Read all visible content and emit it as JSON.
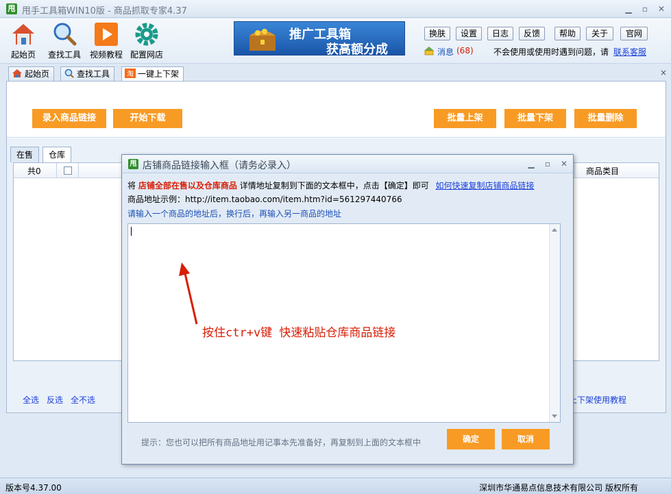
{
  "app": {
    "logo": "甩",
    "title": "甩手工具箱WIN10版 - 商品抓取专家4.37"
  },
  "window_controls": {
    "minimize": "▁",
    "maximize": "▫",
    "close": "✕"
  },
  "toolbar": {
    "items": [
      {
        "label": "起始页",
        "icon": "home-icon"
      },
      {
        "label": "查找工具",
        "icon": "magnifier-icon"
      },
      {
        "label": "视频教程",
        "icon": "play-icon"
      },
      {
        "label": "配置网店",
        "icon": "gear-icon"
      }
    ]
  },
  "banner": {
    "line1": "推广工具箱",
    "line2": "获高额分成"
  },
  "system_buttons": [
    "换肤",
    "设置",
    "日志",
    "反馈",
    "帮助",
    "关于",
    "官网"
  ],
  "messages": {
    "label": "消息",
    "count": "(68)"
  },
  "help": {
    "text": "不会使用或使用时遇到问题，请",
    "link": "联系客服"
  },
  "tabs": [
    {
      "label": "起始页",
      "icon": "home-icon"
    },
    {
      "label": "查找工具",
      "icon": "magnifier-icon"
    },
    {
      "label": "一键上下架",
      "icon": "taobao-icon",
      "active": true
    }
  ],
  "tab_close": "×",
  "actions": {
    "import_links": "录入商品链接",
    "start_download": "开始下载",
    "batch_list": "批量上架",
    "batch_delist": "批量下架",
    "batch_delete": "批量删除"
  },
  "subtabs": [
    {
      "label": "在售"
    },
    {
      "label": "仓库",
      "active": true
    }
  ],
  "grid": {
    "count_label": "共0",
    "columns": [
      "商品类目"
    ]
  },
  "bottom_links": {
    "select_all": "全选",
    "invert": "反选",
    "select_none": "全不选",
    "tutorial": "上下架使用教程"
  },
  "status": {
    "version": "版本号4.37.00",
    "company": "深圳市华通易点信息技术有限公司 版权所有"
  },
  "dialog": {
    "title": "店铺商品链接输入框（请务必录入）",
    "line1_prefix": "将",
    "line1_emph": "店铺全部在售以及仓库商品",
    "line1_suffix": "详情地址复制到下面的文本框中，点击【确定】即可",
    "line1_link": "如何快速复制店铺商品链接",
    "line2": "商品地址示例：http://item.taobao.com/item.htm?id=561297440766",
    "line3": "请输入一个商品的地址后，换行后，再输入另一商品的地址",
    "textarea_value": "",
    "annotation": "按住ctr+v键 快速粘贴仓库商品链接",
    "hint": "提示：您也可以把所有商品地址用记事本先准备好，再复制到上面的文本框中",
    "ok": "确定",
    "cancel": "取消"
  },
  "colors": {
    "accent_orange": "#f89b25",
    "link_blue": "#1b3fd8",
    "alert_red": "#d81e06"
  }
}
